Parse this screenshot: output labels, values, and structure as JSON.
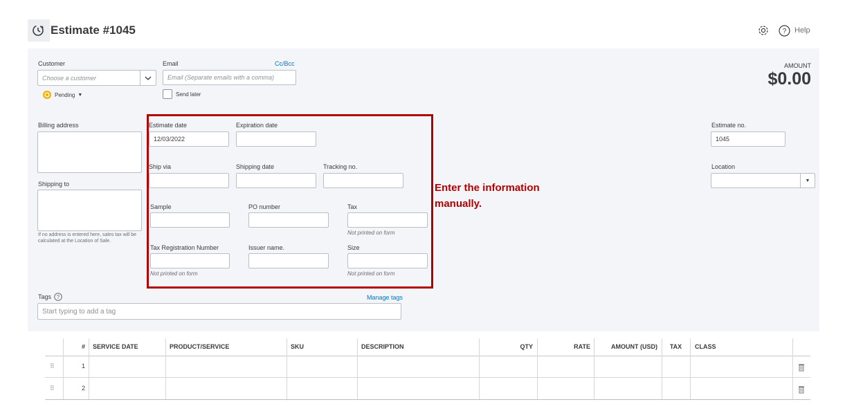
{
  "header": {
    "title": "Estimate #1045",
    "help_label": "Help"
  },
  "customer": {
    "label": "Customer",
    "placeholder": "Choose a customer",
    "status": "Pending"
  },
  "email": {
    "label": "Email",
    "cc_bcc": "Cc/Bcc",
    "placeholder": "Email (Separate emails with a comma)",
    "send_later": "Send later"
  },
  "amount": {
    "label": "AMOUNT",
    "value": "$0.00"
  },
  "billing": {
    "label": "Billing address"
  },
  "shipping": {
    "label": "Shipping to",
    "note": "If no address is entered here, sales tax will be calculated at the Location of Sale."
  },
  "fields": {
    "estimate_date": {
      "label": "Estimate date",
      "value": "12/03/2022"
    },
    "expiration_date": {
      "label": "Expiration date"
    },
    "ship_via": {
      "label": "Ship via"
    },
    "shipping_date": {
      "label": "Shipping date"
    },
    "tracking_no": {
      "label": "Tracking no."
    },
    "sample": {
      "label": "Sample"
    },
    "po_number": {
      "label": "PO number"
    },
    "tax": {
      "label": "Tax",
      "note": "Not printed on form"
    },
    "tax_reg": {
      "label": "Tax Registration Number",
      "note": "Not printed on form"
    },
    "issuer": {
      "label": "Issuer name."
    },
    "size": {
      "label": "Size",
      "note": "Not printed on form"
    }
  },
  "estimate_no": {
    "label": "Estimate no.",
    "value": "1045"
  },
  "location": {
    "label": "Location"
  },
  "annotation": {
    "line1": "Enter the information",
    "line2": "manually."
  },
  "tags": {
    "label": "Tags",
    "manage": "Manage tags",
    "placeholder": "Start typing to add a tag"
  },
  "table": {
    "headers": [
      "#",
      "SERVICE DATE",
      "PRODUCT/SERVICE",
      "SKU",
      "DESCRIPTION",
      "QTY",
      "RATE",
      "AMOUNT (USD)",
      "TAX",
      "CLASS"
    ],
    "rows": [
      {
        "num": "1"
      },
      {
        "num": "2"
      }
    ]
  },
  "colors": {
    "accent_red": "#b00000",
    "link_blue": "#0077c5",
    "panel_bg": "#f4f5f8"
  }
}
